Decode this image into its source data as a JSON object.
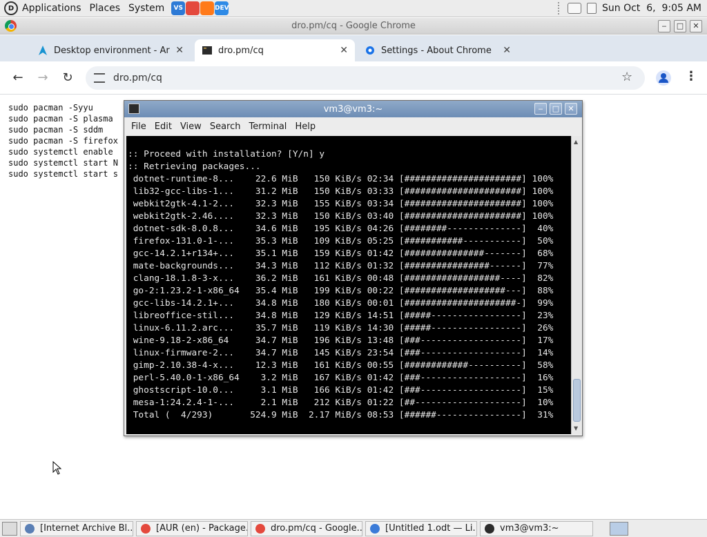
{
  "top_panel": {
    "menus": [
      "Applications",
      "Places",
      "System"
    ],
    "launchers": [
      {
        "icon": "vscode-icon",
        "color": "#2d7ad6",
        "text": "VS"
      },
      {
        "icon": "chrome-icon",
        "color": "#e4493d",
        "text": ""
      },
      {
        "icon": "firefox-icon",
        "color": "#ff7a1a",
        "text": ""
      },
      {
        "icon": "firefox-dev-icon",
        "color": "#2e8ae6",
        "text": "DEV"
      }
    ],
    "clock": "Sun Oct  6,  9:05 AM"
  },
  "chrome": {
    "window_title": "dro.pm/cq - Google Chrome",
    "tabs": [
      {
        "label": "Desktop environment - ArchWiki",
        "close": "✕"
      },
      {
        "label": "dro.pm/cq",
        "close": "✕"
      },
      {
        "label": "Settings - About Chrome",
        "close": "✕"
      }
    ],
    "address": "dro.pm/cq"
  },
  "page": {
    "lines": [
      "sudo pacman -Syyu",
      "sudo pacman -S plasma",
      "sudo pacman -S sddm",
      "sudo pacman -S firefox",
      "sudo systemctl enable",
      "sudo systemctl start N",
      "sudo systemctl start s"
    ]
  },
  "terminal": {
    "title": "vm3@vm3:~",
    "menu": [
      "File",
      "Edit",
      "View",
      "Search",
      "Terminal",
      "Help"
    ],
    "lines": [
      ":: Proceed with installation? [Y/n] y",
      ":: Retrieving packages...",
      " dotnet-runtime-8...    22.6 MiB   150 KiB/s 02:34 [######################] 100%",
      " lib32-gcc-libs-1...    31.2 MiB   150 KiB/s 03:33 [######################] 100%",
      " webkit2gtk-4.1-2...    32.3 MiB   155 KiB/s 03:34 [######################] 100%",
      " webkit2gtk-2.46....    32.3 MiB   150 KiB/s 03:40 [######################] 100%",
      " dotnet-sdk-8.0.8...    34.6 MiB   195 KiB/s 04:26 [########--------------]  40%",
      " firefox-131.0-1-...    35.3 MiB   109 KiB/s 05:25 [###########-----------]  50%",
      " gcc-14.2.1+r134+...    35.1 MiB   159 KiB/s 01:42 [###############-------]  68%",
      " mate-backgrounds...    34.3 MiB   112 KiB/s 01:32 [################------]  77%",
      " clang-18.1.8-3-x...    36.2 MiB   161 KiB/s 00:48 [##################----]  82%",
      " go-2:1.23.2-1-x86_64   35.4 MiB   199 KiB/s 00:22 [###################---]  88%",
      " gcc-libs-14.2.1+...    34.8 MiB   180 KiB/s 00:01 [#####################-]  99%",
      " libreoffice-stil...    34.8 MiB   129 KiB/s 14:51 [#####-----------------]  23%",
      " linux-6.11.2.arc...    35.7 MiB   119 KiB/s 14:30 [#####-----------------]  26%",
      " wine-9.18-2-x86_64     34.7 MiB   196 KiB/s 13:48 [###-------------------]  17%",
      " linux-firmware-2...    34.7 MiB   145 KiB/s 23:54 [###-------------------]  14%",
      " gimp-2.10.38-4-x...    12.3 MiB   161 KiB/s 00:55 [############----------]  58%",
      " perl-5.40.0-1-x86_64    3.2 MiB   167 KiB/s 01:42 [###-------------------]  16%",
      " ghostscript-10.0...     3.1 MiB   166 KiB/s 01:42 [###-------------------]  15%",
      " mesa-1:24.2.4-1-...     2.1 MiB   212 KiB/s 01:22 [##--------------------]  10%",
      " Total (  4/293)       524.9 MiB  2.17 MiB/s 08:53 [######----------------]  31%"
    ]
  },
  "taskbar": {
    "tasks": [
      {
        "label": "[Internet Archive Bl...",
        "icon": "archive-icon",
        "color": "#5a7fb5"
      },
      {
        "label": "[AUR (en) - Package...",
        "icon": "chrome-icon",
        "color": "#e4493d"
      },
      {
        "label": "dro.pm/cq - Google...",
        "icon": "chrome-icon",
        "color": "#e4493d"
      },
      {
        "label": "[Untitled 1.odt — Li...",
        "icon": "writer-icon",
        "color": "#3b7bd8"
      },
      {
        "label": "vm3@vm3:~",
        "icon": "terminal-icon",
        "color": "#2b2b2b"
      }
    ]
  }
}
